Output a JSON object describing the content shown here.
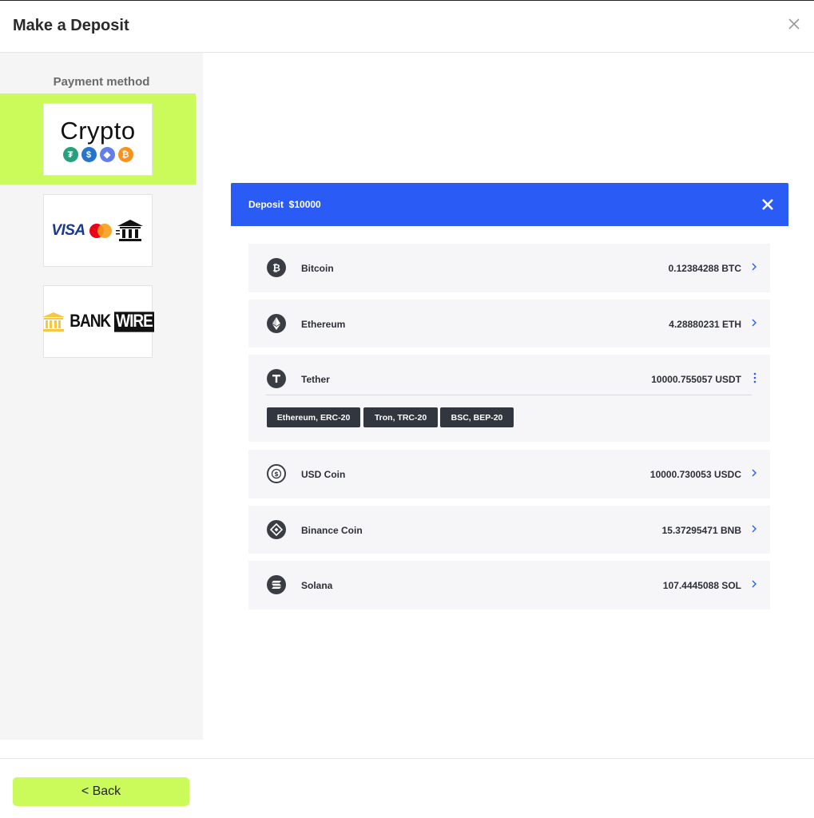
{
  "header": {
    "title": "Make a Deposit"
  },
  "sidebar": {
    "title": "Payment method",
    "methods": [
      {
        "id": "crypto",
        "logo_text": "Crypto",
        "active": true
      },
      {
        "id": "card",
        "logo_text": "VISA",
        "active": false
      },
      {
        "id": "bankwire",
        "logo_text_1": "BANK",
        "logo_text_2": "WIRE",
        "active": false
      }
    ]
  },
  "panel": {
    "title": "Deposit  $10000"
  },
  "coins": [
    {
      "name": "Bitcoin",
      "amount": "0.12384288 BTC",
      "icon": "bitcoin-icon"
    },
    {
      "name": "Ethereum",
      "amount": "4.28880231 ETH",
      "icon": "ethereum-icon"
    },
    {
      "name": "Tether",
      "amount": "10000.755057 USDT",
      "icon": "tether-icon",
      "networks": [
        "Ethereum, ERC-20",
        "Tron, TRC-20",
        "BSC, BEP-20"
      ]
    },
    {
      "name": "USD Coin",
      "amount": "10000.730053 USDC",
      "icon": "usdc-icon"
    },
    {
      "name": "Binance Coin",
      "amount": "15.37295471 BNB",
      "icon": "bnb-icon"
    },
    {
      "name": "Solana",
      "amount": "107.4445088 SOL",
      "icon": "solana-icon"
    }
  ],
  "footer": {
    "back_label": "< Back"
  },
  "colors": {
    "accent": "#cbfb5b",
    "panel_blue": "#2a5cf5",
    "dark": "#32363e"
  }
}
